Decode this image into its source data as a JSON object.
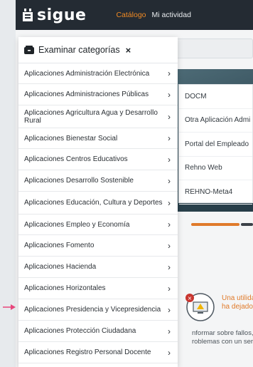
{
  "header": {
    "logo_text": "sigue",
    "nav": [
      {
        "label": "Catálogo"
      },
      {
        "label": "Mi actividad"
      }
    ]
  },
  "dropdown": {
    "title": "Examinar categorías",
    "close": "×",
    "items": [
      {
        "label": "Aplicaciones Administración Electrónica"
      },
      {
        "label": "Aplicaciones Administraciones Públicas"
      },
      {
        "label": "Aplicaciones Agricultura Agua y Desarrollo Rural"
      },
      {
        "label": "Aplicaciones Bienestar Social"
      },
      {
        "label": "Aplicaciones Centros Educativos"
      },
      {
        "label": "Aplicaciones Desarrollo Sostenible"
      },
      {
        "label": "Aplicaciones Educación, Cultura y Deportes"
      },
      {
        "label": "Aplicaciones Empleo y Economía"
      },
      {
        "label": "Aplicaciones Fomento"
      },
      {
        "label": "Aplicaciones Hacienda"
      },
      {
        "label": "Aplicaciones Horizontales"
      },
      {
        "label": "Aplicaciones Presidencia y Vicepresidencia"
      },
      {
        "label": "Aplicaciones Protección Ciudadana"
      },
      {
        "label": "Aplicaciones Registro Personal Docente"
      }
    ]
  },
  "apps_submenu": {
    "items": [
      {
        "label": "DOCM"
      },
      {
        "label": "Otra Aplicación Admi"
      },
      {
        "label": "Portal del Empleado"
      },
      {
        "label": "Rehno Web"
      },
      {
        "label": "REHNO-Meta4"
      }
    ]
  },
  "alert": {
    "line1": "Una utilida",
    "line2": "ha dejado"
  },
  "info": {
    "line1": "nformar sobre fallos, er",
    "line2": "roblemas con un servic"
  },
  "colors": {
    "navbar": "#242b33",
    "accent": "#f08a24",
    "progress": "#e07a2a"
  }
}
